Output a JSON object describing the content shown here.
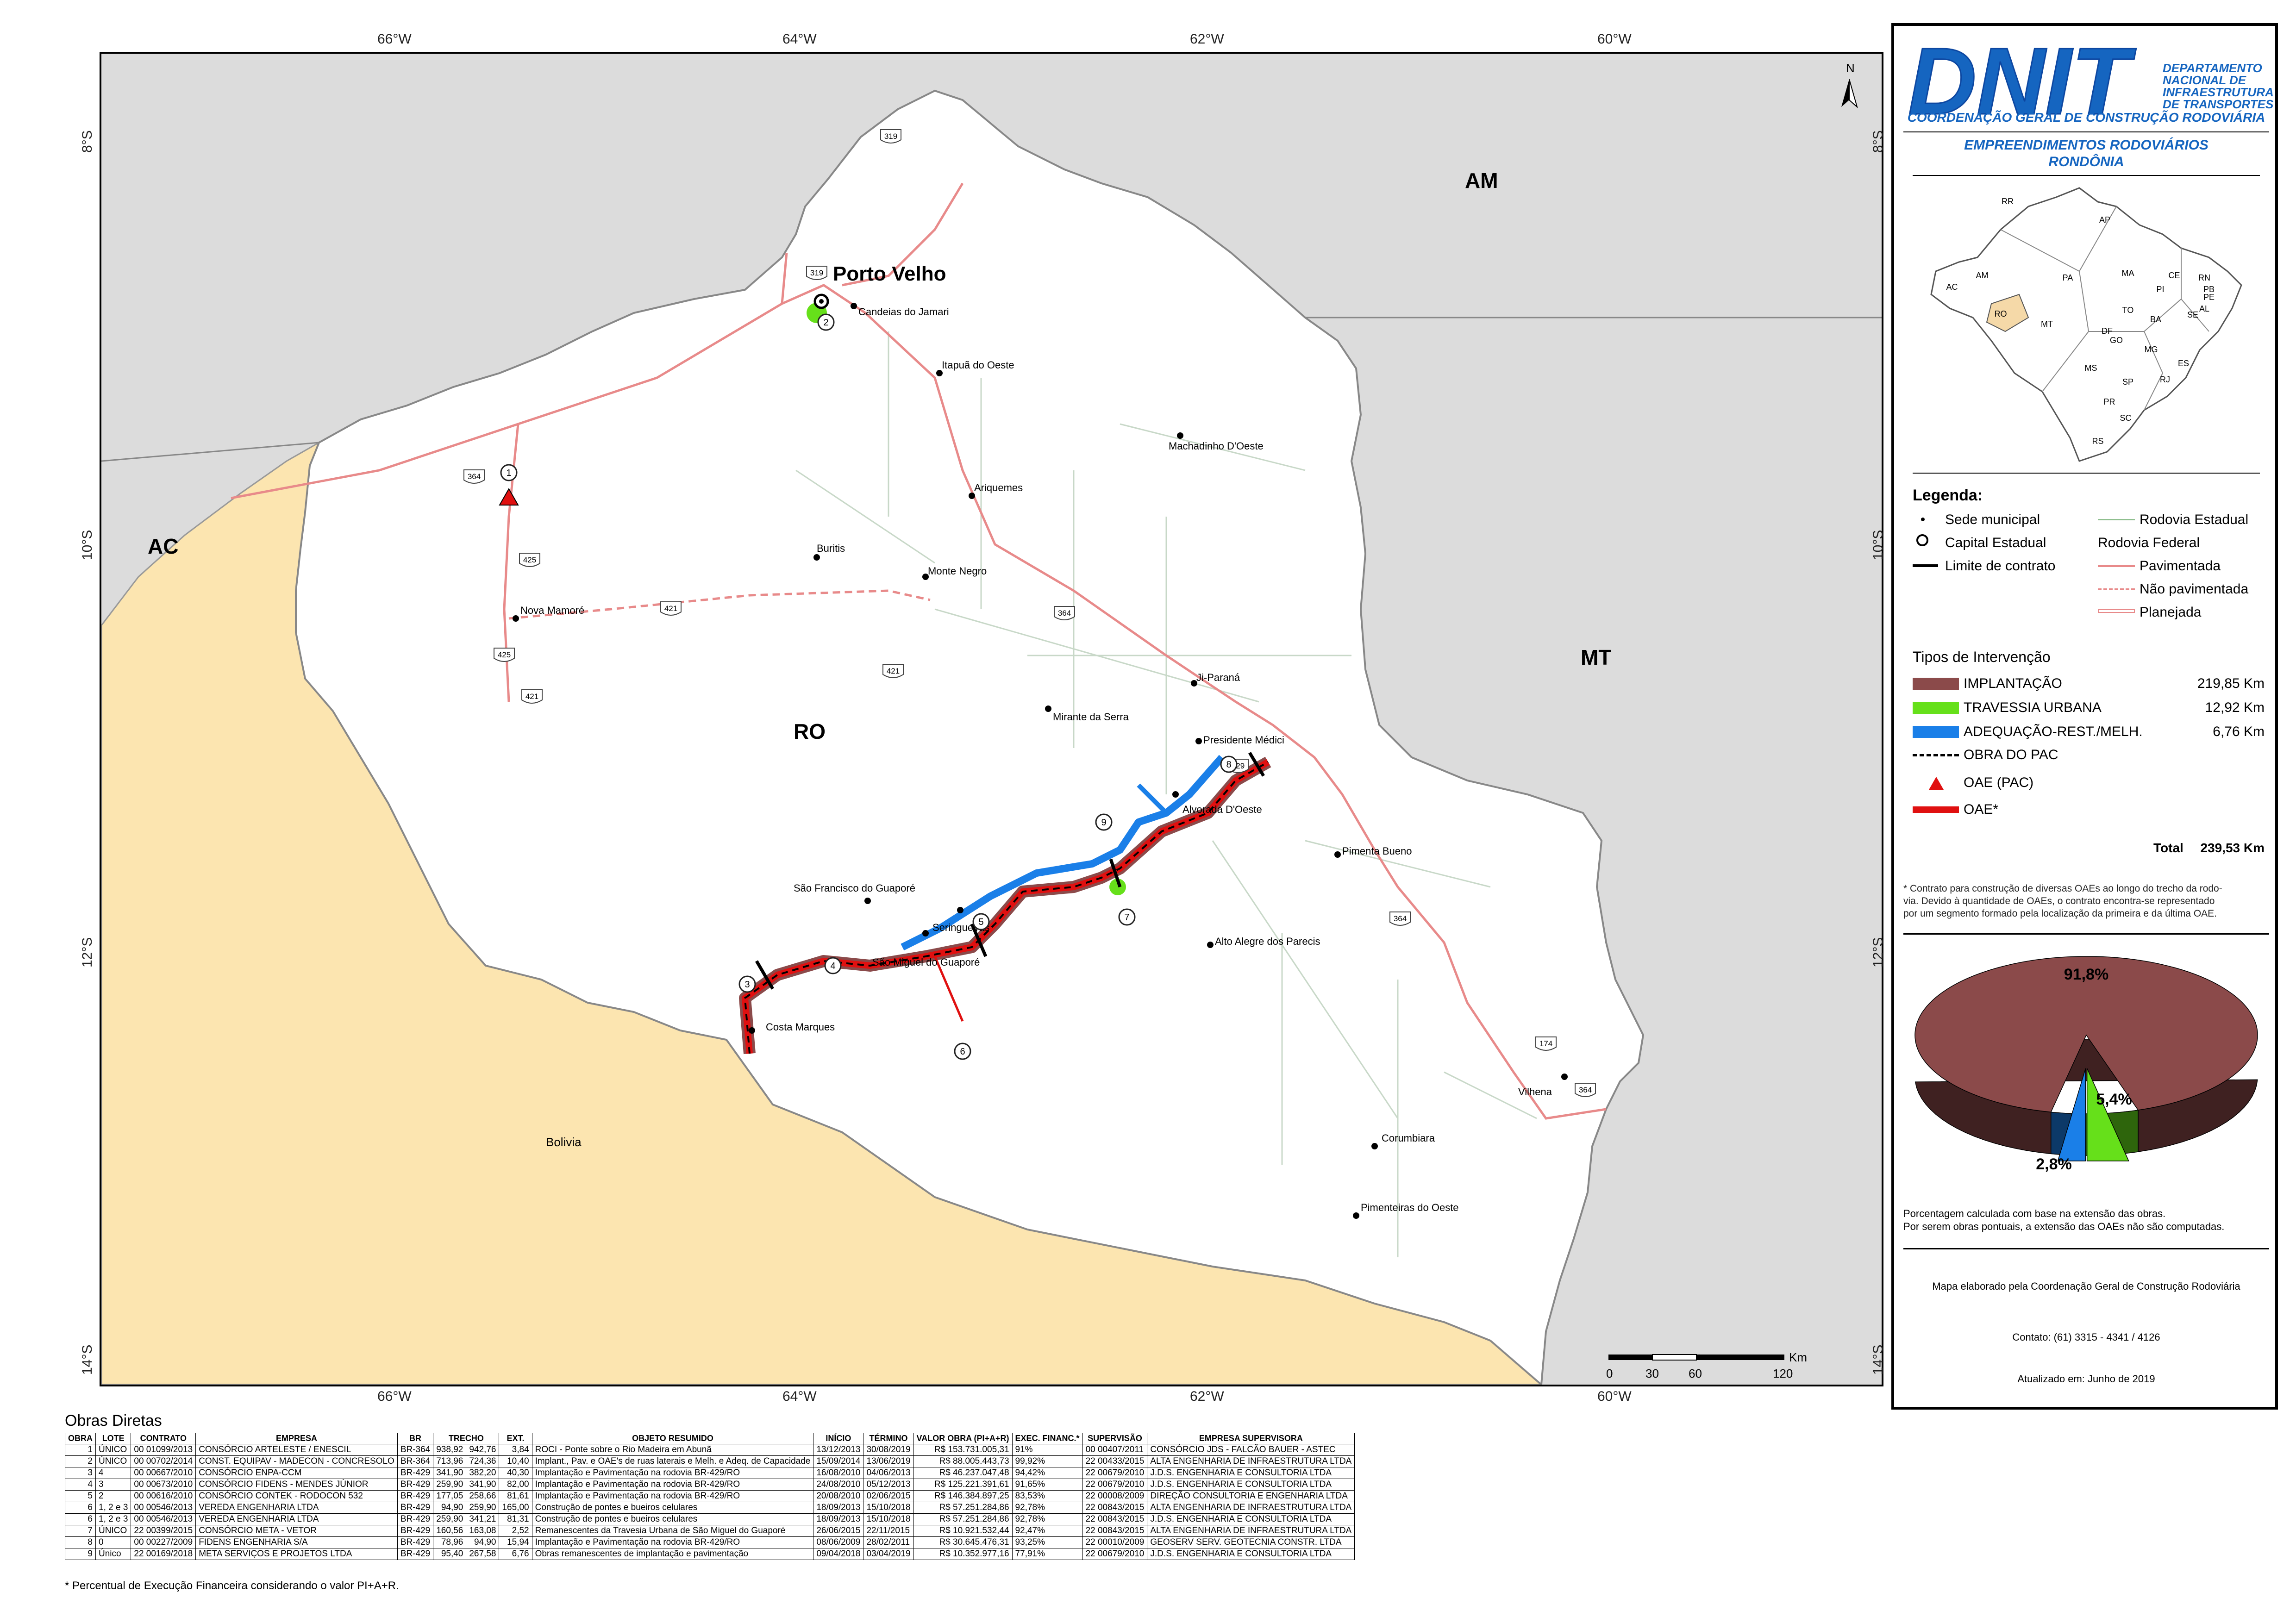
{
  "map": {
    "lon_ticks": [
      "66°W",
      "64°W",
      "62°W",
      "60°W"
    ],
    "lat_ticks": [
      "8°S",
      "10°S",
      "12°S",
      "14°S"
    ],
    "regions": {
      "am": "AM",
      "ac": "AC",
      "mt": "MT",
      "ro": "RO",
      "bolivia": "Bolivia"
    },
    "capital": "Porto Velho",
    "north_label": "N",
    "cities": [
      "Candeias do Jamari",
      "Itapuã do Oeste",
      "Machadinho D'Oeste",
      "Ariquemes",
      "Buritis",
      "Monte Negro",
      "Nova Mamoré",
      "Ji-Paraná",
      "Mirante da Serra",
      "Presidente Médici",
      "Alvorada D'Oeste",
      "São Francisco do Guaporé",
      "Seringueiras",
      "São Miguel do Guaporé",
      "Costa Marques",
      "Pimenta Bueno",
      "Alto Alegre dos Parecis",
      "Corumbiara",
      "Vilhena",
      "Pimenteiras do Oeste"
    ],
    "road_numbers": [
      "319",
      "319",
      "364",
      "425",
      "421",
      "421",
      "425",
      "364",
      "421",
      "429",
      "364",
      "174",
      "364"
    ],
    "work_markers": [
      "1",
      "2",
      "3",
      "4",
      "5",
      "6",
      "7",
      "8",
      "9"
    ],
    "scale": {
      "unit": "Km",
      "ticks": [
        "0",
        "30",
        "60",
        "120"
      ]
    }
  },
  "header": {
    "logo_text": "DNIT",
    "org_lines": [
      "DEPARTAMENTO",
      "NACIONAL DE",
      "INFRAESTRUTURA",
      "DE TRANSPORTES"
    ],
    "coord": "COORDENAÇÃO GERAL DE CONSTRUÇÃO RODOVIÁRIA",
    "title1": "EMPREENDIMENTOS RODOVIÁRIOS",
    "title2": "RONDÔNIA"
  },
  "brazil_states": [
    "RR",
    "AP",
    "AM",
    "PA",
    "MA",
    "CE",
    "RN",
    "PB",
    "PE",
    "AL",
    "SE",
    "PI",
    "TO",
    "BA",
    "AC",
    "RO",
    "MT",
    "GO",
    "DF",
    "MG",
    "ES",
    "MS",
    "SP",
    "RJ",
    "PR",
    "SC",
    "RS"
  ],
  "legend": {
    "title": "Legenda:",
    "sede": "Sede municipal",
    "capital": "Capital Estadual",
    "limite": "Limite de contrato",
    "rod_estadual": "Rodovia Estadual",
    "rod_federal": "Rodovia Federal",
    "pavimentada": "Pavimentada",
    "nao_pav": "Não pavimentada",
    "planejada": "Planejada"
  },
  "tipos": {
    "title": "Tipos de Intervenção",
    "items": [
      {
        "label": "IMPLANTAÇÃO",
        "value": "219,85 Km",
        "color": "#8b4a4a"
      },
      {
        "label": "TRAVESSIA URBANA",
        "value": "12,92 Km",
        "color": "#66e01a"
      },
      {
        "label": "ADEQUAÇÃO-REST./MELH.",
        "value": "6,76 Km",
        "color": "#1a7fe8"
      }
    ],
    "obra_pac": "OBRA DO PAC",
    "oae_pac": "OAE (PAC)",
    "oae": "OAE*",
    "total_label": "Total",
    "total_value": "239,53 Km",
    "footnote": [
      "* Contrato para construção de diversas OAEs ao longo do trecho da rodo-",
      "via. Devido à quantidade de OAEs, o contrato encontra-se representado",
      "por um segmento formado pela localização da primeira e da última OAE."
    ]
  },
  "pie": {
    "slices": [
      {
        "label": "91,8%",
        "value": 91.8,
        "color": "#8b4a4a"
      },
      {
        "label": "5,4%",
        "value": 5.4,
        "color": "#66e01a"
      },
      {
        "label": "2,8%",
        "value": 2.8,
        "color": "#1a7fe8"
      }
    ],
    "note1": "Porcentagem calculada com base na extensão das obras.",
    "note2": "Por serem obras pontuais, a extensão das OAEs não são computadas."
  },
  "credits": {
    "elaborado": "Mapa elaborado pela Coordenação Geral de Construção Rodoviária",
    "contato": "Contato: (61) 3315 - 4341 / 4126",
    "atualizado": "Atualizado em: Junho de 2019"
  },
  "obras": {
    "title": "Obras Diretas",
    "headers": [
      "OBRA",
      "LOTE",
      "CONTRATO",
      "EMPRESA",
      "BR",
      "TRECHO",
      "EXT.",
      "OBJETO RESUMIDO",
      "INÍCIO",
      "TÉRMINO",
      "VALOR OBRA (PI+A+R)",
      "EXEC. FINANC.*",
      "SUPERVISÃO",
      "EMPRESA SUPERVISORA"
    ],
    "rows": [
      [
        "1",
        "ÚNICO",
        "00 01099/2013",
        "CONSÓRCIO ARTELESTE / ENESCIL",
        "BR-364",
        "938,92",
        "942,76",
        "3,84",
        "ROCI - Ponte sobre o Rio Madeira em Abunã",
        "13/12/2013",
        "30/08/2019",
        "R$ 153.731.005,31",
        "91%",
        "00 00407/2011",
        "CONSÓRCIO JDS - FALCÃO BAUER - ASTEC"
      ],
      [
        "2",
        "ÚNICO",
        "00 00702/2014",
        "CONST. EQUIPAV - MADECON - CONCRESOLO",
        "BR-364",
        "713,96",
        "724,36",
        "10,40",
        "Implant., Pav. e OAE's de ruas laterais e Melh. e Adeq. de Capacidade",
        "15/09/2014",
        "13/06/2019",
        "R$ 88.005.443,73",
        "99,92%",
        "22 00433/2015",
        "ALTA ENGENHARIA DE INFRAESTRUTURA LTDA"
      ],
      [
        "3",
        "4",
        "00 00667/2010",
        "CONSÓRCIO ENPA-CCM",
        "BR-429",
        "341,90",
        "382,20",
        "40,30",
        "Implantação e Pavimentação na rodovia BR-429/RO",
        "16/08/2010",
        "04/06/2013",
        "R$ 46.237.047,48",
        "94,42%",
        "22 00679/2010",
        "J.D.S. ENGENHARIA E CONSULTORIA LTDA"
      ],
      [
        "4",
        "3",
        "00 00673/2010",
        "CONSÓRCIO FIDENS - MENDES JÚNIOR",
        "BR-429",
        "259,90",
        "341,90",
        "82,00",
        "Implantação e Pavimentação na rodovia BR-429/RO",
        "24/08/2010",
        "05/12/2013",
        "R$ 125.221.391,61",
        "91,65%",
        "22 00679/2010",
        "J.D.S. ENGENHARIA E CONSULTORIA LTDA"
      ],
      [
        "5",
        "2",
        "00 00616/2010",
        "CONSÓRCIO CONTEK - RODOCON 532",
        "BR-429",
        "177,05",
        "258,66",
        "81,61",
        "Implantação e Pavimentação na rodovia BR-429/RO",
        "20/08/2010",
        "02/06/2015",
        "R$ 146.384.897,25",
        "83,53%",
        "22 00008/2009",
        "DIREÇÃO CONSULTORIA E ENGENHARIA LTDA"
      ],
      [
        "6",
        "1, 2 e 3",
        "00 00546/2013",
        "VEREDA ENGENHARIA LTDA",
        "BR-429",
        "94,90",
        "259,90",
        "165,00",
        "Construção de pontes e bueiros celulares",
        "18/09/2013",
        "15/10/2018",
        "R$ 57.251.284,86",
        "92,78%",
        "22 00843/2015",
        "ALTA ENGENHARIA DE INFRAESTRUTURA LTDA"
      ],
      [
        "6",
        "1, 2 e 3",
        "00 00546/2013",
        "VEREDA ENGENHARIA LTDA",
        "BR-429",
        "259,90",
        "341,21",
        "81,31",
        "Construção de pontes e bueiros celulares",
        "18/09/2013",
        "15/10/2018",
        "R$ 57.251.284,86",
        "92,78%",
        "22 00843/2015",
        "J.D.S. ENGENHARIA E CONSULTORIA LTDA"
      ],
      [
        "7",
        "ÚNICO",
        "22 00399/2015",
        "CONSÓRCIO META - VETOR",
        "BR-429",
        "160,56",
        "163,08",
        "2,52",
        "Remanescentes da Travesia Urbana de São Miguel do Guaporé",
        "26/06/2015",
        "22/11/2015",
        "R$ 10.921.532,44",
        "92,47%",
        "22 00843/2015",
        "ALTA ENGENHARIA DE INFRAESTRUTURA LTDA"
      ],
      [
        "8",
        "0",
        "00 00227/2009",
        "FIDENS ENGENHARIA S/A",
        "BR-429",
        "78,96",
        "94,90",
        "15,94",
        "Implantação e Pavimentação na rodovia BR-429/RO",
        "08/06/2009",
        "28/02/2011",
        "R$ 30.645.476,31",
        "93,25%",
        "22 00010/2009",
        "GEOSERV SERV. GEOTECNIA CONSTR. LTDA"
      ],
      [
        "9",
        "Único",
        "22 00169/2018",
        "META SERVIÇOS E PROJETOS LTDA",
        "BR-429",
        "95,40",
        "267,58",
        "6,76",
        "Obras remanescentes de implantação e pavimentação",
        "09/04/2018",
        "03/04/2019",
        "R$ 10.352.977,16",
        "77,91%",
        "22 00679/2010",
        "J.D.S. ENGENHARIA E CONSULTORIA LTDA"
      ]
    ],
    "footnote": "* Percentual de Execução Financeira considerando o valor PI+A+R."
  },
  "colors": {
    "bolivia": "#fce5b0",
    "neighbor": "#dcdcdc",
    "ro": "#ffffff",
    "road": "#e88a8a",
    "implantacao": "#8b4a4a",
    "travessia": "#66e01a",
    "adequacao": "#1a7fe8",
    "oae": "#e01010",
    "dnit_blue": "#1565c0"
  }
}
